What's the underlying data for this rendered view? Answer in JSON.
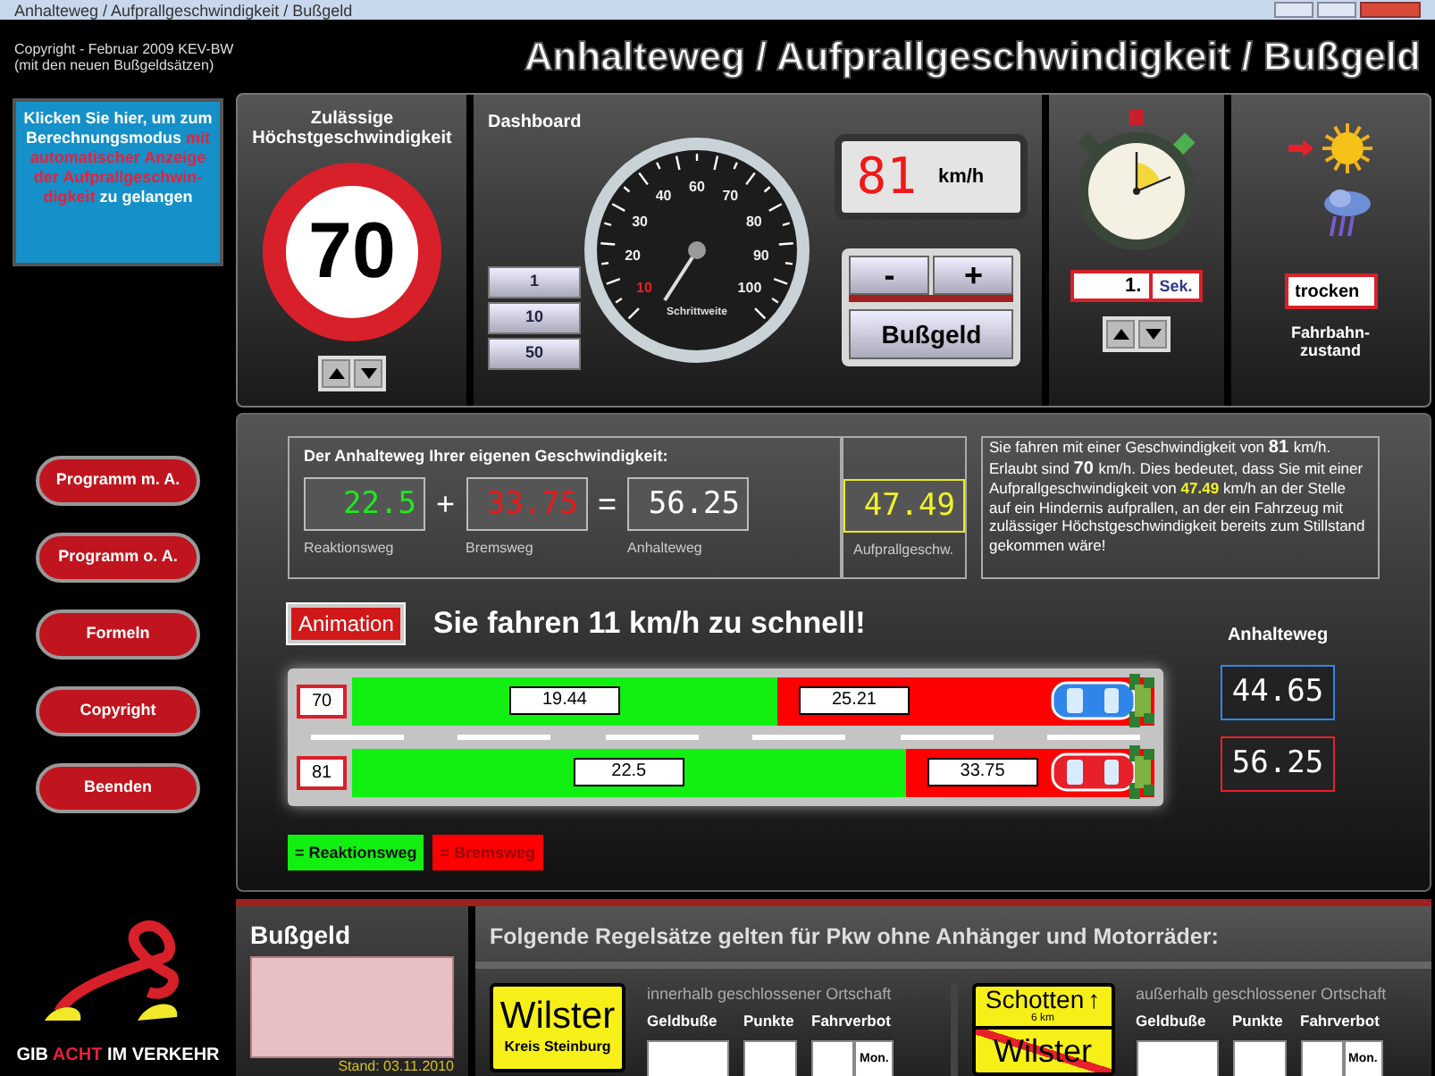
{
  "window": {
    "title": "Anhalteweg / Aufprallgeschwindigkeit / Bußgeld"
  },
  "header": {
    "copyright": "Copyright - Februar 2009 KEV-BW",
    "note": "(mit den neuen Bußgeldsätzen)",
    "title": "Anhalteweg / Aufprallgeschwindigkeit / Bußgeld"
  },
  "mode_hint": [
    {
      "text": "Klicken Sie  hier, um zum Berechnungsmodus",
      "color": "#ffffff"
    },
    {
      "text": "mit automatischer Anzeige der Aufprallgeschwin-digkeit",
      "color": "#e8203a"
    },
    {
      "text": "zu gelangen",
      "color": "#ffffff"
    }
  ],
  "menu": [
    "Programm m. A.",
    "Programm o. A.",
    "Formeln",
    "Copyright",
    "Beenden"
  ],
  "logo": [
    {
      "text": "GIB",
      "color": "#ffffff"
    },
    {
      "text": "ACHT",
      "color": "#e8203a"
    },
    {
      "text": "IM VERKEHR",
      "color": "#ffffff"
    }
  ],
  "speed_limit": {
    "title": "Zulässige Höchstgeschwindigkeit",
    "value": "70"
  },
  "dashboard": {
    "title": "Dashboard",
    "gauge_ticks": [
      "10",
      "20",
      "30",
      "40",
      "60",
      "70",
      "80",
      "90",
      "100"
    ],
    "gauge_label": "Schrittweite",
    "steps": [
      "1",
      "10",
      "50"
    ],
    "speed": "81",
    "unit": "km/h",
    "buttons": [
      "-",
      "+"
    ],
    "fine_button": "Bußgeld"
  },
  "reaction_time": {
    "value": "1.",
    "unit": "Sek."
  },
  "road": {
    "conditions": [
      {
        "kind": "sun",
        "selected": true
      },
      {
        "kind": "rain",
        "selected": false
      }
    ],
    "value": "trocken",
    "label": "Fahrbahn-zustand"
  },
  "result": {
    "title": "Der Anhalteweg Ihrer eigenen Geschwindigkeit:",
    "operators": [
      "+",
      "="
    ],
    "items": [
      {
        "kind": "reaction",
        "value": "22.5",
        "label": "Reaktionsweg"
      },
      {
        "kind": "brake",
        "value": "33.75",
        "label": "Bremsweg"
      },
      {
        "kind": "total",
        "value": "56.25",
        "label": "Anhalteweg"
      },
      {
        "kind": "impact",
        "value": "47.49",
        "label": "Aufprallgeschw."
      }
    ]
  },
  "explanation": [
    {
      "kind": "text",
      "text": "Sie fahren mit einer Geschwindigkeit von"
    },
    {
      "kind": "bold",
      "text": "81"
    },
    {
      "kind": "text",
      "text": "km/h. Erlaubt sind"
    },
    {
      "kind": "bold",
      "text": "70"
    },
    {
      "kind": "text",
      "text": "km/h.  Dies bedeutet, dass Sie mit einer Aufprallgeschwindigkeit  von"
    },
    {
      "kind": "highlight",
      "text": "47.49"
    },
    {
      "kind": "text",
      "text": "km/h an der Stelle auf ein Hindernis aufprallen, an der ein Fahrzeug mit  zulässiger Höchstgeschwindigkeit bereits zum Stillstand gekommen wäre!"
    }
  ],
  "animation": {
    "button": "Animation",
    "message": "Sie fahren 11 km/h zu schnell!",
    "distance_title": "Anhalteweg",
    "lanes": [
      {
        "speed": "70",
        "reaction": {
          "value": "19.44",
          "level": 0.53
        },
        "braking": {
          "value": "25.21"
        },
        "color": "#2f86e8",
        "distance": "44.65"
      },
      {
        "speed": "81",
        "reaction": {
          "value": "22.5",
          "level": 0.69
        },
        "braking": {
          "value": "33.75"
        },
        "color": "#e8202a",
        "distance": "56.25"
      }
    ],
    "legend": [
      {
        "kind": "reaction",
        "label": "= Reaktionsweg"
      },
      {
        "kind": "brake",
        "label": "= Bremsweg"
      }
    ]
  },
  "fine": {
    "title": "Bußgeld",
    "date": "Stand: 03.11.2010"
  },
  "rules": {
    "title": "Folgende Regelsätze gelten für Pkw ohne Anhänger und Motorräder:",
    "sections": [
      {
        "kind": "town_entry",
        "sign": {
          "name": "Wilster",
          "district": "Kreis Steinburg"
        },
        "area": "innerhalb geschlossener Ortschaft",
        "columns": [
          "Geldbuße",
          "Punkte",
          "Fahrverbot"
        ],
        "unit": "Mon."
      },
      {
        "kind": "town_exit",
        "sign": {
          "name": "Schotten",
          "arrow": "↑",
          "distance": "6 km",
          "crossed": "Wilster"
        },
        "area": "außerhalb geschlossener Ortschaft",
        "columns": [
          "Geldbuße",
          "Punkte",
          "Fahrverbot"
        ],
        "unit": "Mon."
      }
    ]
  }
}
